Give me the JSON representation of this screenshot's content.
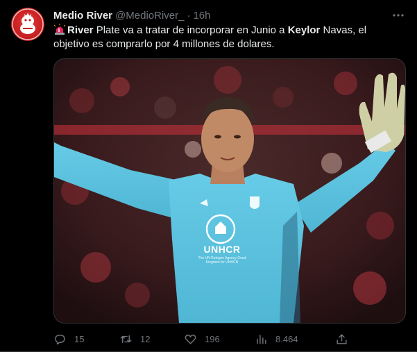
{
  "tweet": {
    "author_name": "Medio River",
    "handle": "@MedioRiver_",
    "separator": "·",
    "time": "16h",
    "text": {
      "bold1": "River",
      "part1": " Plate va a tratar de incorporar en Junio a ",
      "bold2": "Keylor",
      "part2": " Navas, el objetivo es comprarlo por 4 millones de dolares."
    },
    "media": {
      "sponsor_logo": "UNHCR",
      "sponsor_subtext": "The UN Refugee Agency Good Kingdom for UNHCR"
    },
    "actions": {
      "replies": "15",
      "reposts": "12",
      "likes": "196",
      "views": "8.464"
    }
  },
  "icons": [
    "siren-icon",
    "more-icon",
    "reply-icon",
    "repost-icon",
    "like-icon",
    "views-icon",
    "share-icon"
  ],
  "colors": {
    "background": "#000000",
    "text": "#e7e9ea",
    "muted": "#71767b",
    "jersey": "#5bc3e0"
  }
}
